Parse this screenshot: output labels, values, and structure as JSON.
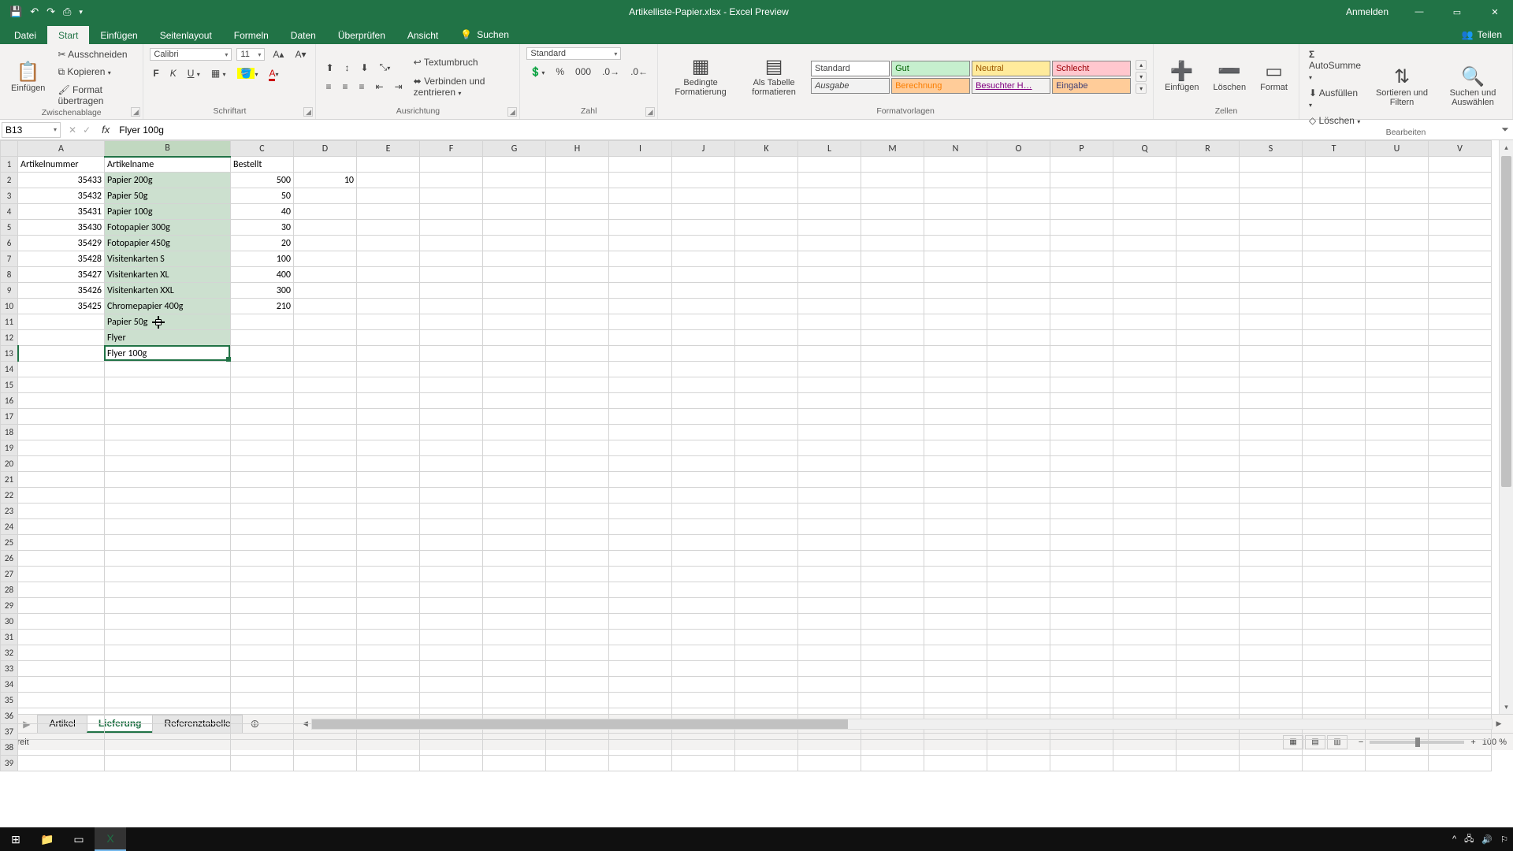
{
  "titlebar": {
    "title": "Artikelliste-Papier.xlsx - Excel Preview",
    "login": "Anmelden"
  },
  "ribbon_tabs": {
    "file": "Datei",
    "items": [
      "Start",
      "Einfügen",
      "Seitenlayout",
      "Formeln",
      "Daten",
      "Überprüfen",
      "Ansicht"
    ],
    "active": "Start",
    "search": "Suchen",
    "share": "Teilen"
  },
  "ribbon": {
    "clipboard": {
      "paste": "Einfügen",
      "cut": "Ausschneiden",
      "copy": "Kopieren",
      "format_painter": "Format übertragen",
      "label": "Zwischenablage"
    },
    "font": {
      "name": "Calibri",
      "size": "11",
      "label": "Schriftart"
    },
    "alignment": {
      "wrap": "Textumbruch",
      "merge": "Verbinden und zentrieren",
      "label": "Ausrichtung"
    },
    "number": {
      "format": "Standard",
      "label": "Zahl"
    },
    "styles": {
      "cond": "Bedingte Formatierung",
      "table": "Als Tabelle formatieren",
      "s_standard": "Standard",
      "s_gut": "Gut",
      "s_neutral": "Neutral",
      "s_schlecht": "Schlecht",
      "s_ausgabe": "Ausgabe",
      "s_berechnung": "Berechnung",
      "s_besucht": "Besuchter H…",
      "s_eingabe": "Eingabe",
      "label": "Formatvorlagen"
    },
    "cells": {
      "insert": "Einfügen",
      "delete": "Löschen",
      "format": "Format",
      "label": "Zellen"
    },
    "editing": {
      "autosum": "AutoSumme",
      "fill": "Ausfüllen",
      "clear": "Löschen",
      "sort": "Sortieren und Filtern",
      "find": "Suchen und Auswählen",
      "label": "Bearbeiten"
    }
  },
  "formula_bar": {
    "name_box": "B13",
    "formula": "Flyer 100g"
  },
  "columns": [
    "A",
    "B",
    "C",
    "D",
    "E",
    "F",
    "G",
    "H",
    "I",
    "J",
    "K",
    "L",
    "M",
    "N",
    "O",
    "P",
    "Q",
    "R",
    "S",
    "T",
    "U",
    "V"
  ],
  "headers": {
    "A": "Artikelnummer",
    "B": "Artikelname",
    "C": "Bestellt"
  },
  "rows": [
    {
      "A": "35433",
      "B": "Papier 200g",
      "C": "500",
      "D": "10"
    },
    {
      "A": "35432",
      "B": "Papier 50g",
      "C": "50"
    },
    {
      "A": "35431",
      "B": "Papier 100g",
      "C": "40"
    },
    {
      "A": "35430",
      "B": "Fotopapier 300g",
      "C": "30"
    },
    {
      "A": "35429",
      "B": "Fotopapier 450g",
      "C": "20"
    },
    {
      "A": "35428",
      "B": "Visitenkarten S",
      "C": "100"
    },
    {
      "A": "35427",
      "B": "Visitenkarten XL",
      "C": "400"
    },
    {
      "A": "35426",
      "B": "Visitenkarten XXL",
      "C": "300"
    },
    {
      "A": "35425",
      "B": "Chromepapier 400g",
      "C": "210"
    },
    {
      "B": "Papier 50g"
    },
    {
      "B": "Flyer"
    },
    {
      "B": "Flyer 100g"
    }
  ],
  "selection": {
    "active": "B13",
    "range_col": "B",
    "range_row_start": 2,
    "range_row_end": 13
  },
  "sheet_tabs": {
    "items": [
      "Artikel",
      "Lieferung",
      "Referenztabelle"
    ],
    "active": "Lieferung"
  },
  "status": {
    "ready": "Bereit",
    "zoom": "100 %"
  }
}
